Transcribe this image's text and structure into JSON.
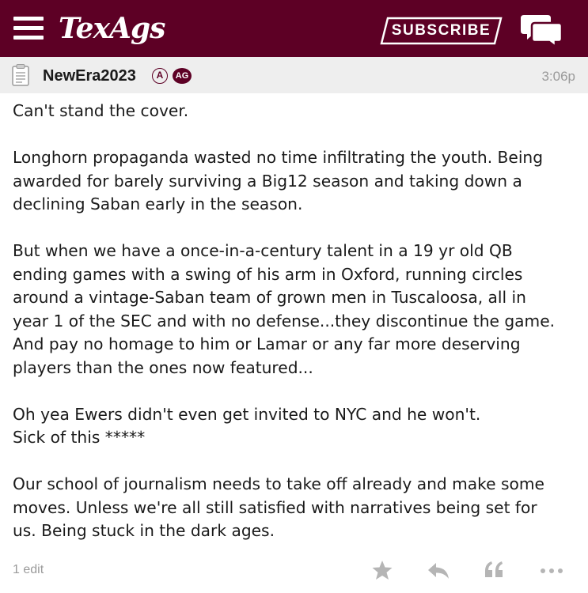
{
  "header": {
    "logo_text": "TexAgs",
    "subscribe_label": "SUBSCRIBE",
    "brand_color": "#5d0025",
    "menu_icon": "hamburger-menu-icon",
    "chat_icon": "chat-bubbles-icon"
  },
  "post": {
    "author": "NewEra2023",
    "badge_a": "A",
    "badge_ag": "AG",
    "time": "3:06p",
    "paragraphs": [
      [
        "Can't stand the cover."
      ],
      [
        "Longhorn propaganda wasted no time infiltrating the youth. Being",
        "awarded for barely surviving a Big12 season and taking down a",
        "declining Saban early in the season."
      ],
      [
        "But when we have a once-in-a-century talent in a 19 yr old QB",
        "ending games with a swing of his arm in Oxford, running circles",
        "around a vintage-Saban team of grown men in Tuscaloosa, all in",
        "year 1 of the SEC and with no defense...they discontinue the game.",
        "And pay no homage to him or Lamar or any far more deserving",
        "players than the ones now featured..."
      ],
      [
        "Oh yea Ewers didn't even get invited to NYC and he won't.",
        "Sick of this *****"
      ],
      [
        "Our school of journalism needs to take off already and make some",
        "moves. Unless we're all still satisfied with narratives being set for",
        "us. Being stuck in the dark ages."
      ]
    ],
    "edit_label": "1 edit"
  },
  "actions": [
    {
      "icon": "star-icon"
    },
    {
      "icon": "reply-icon"
    },
    {
      "icon": "quote-icon"
    },
    {
      "icon": "more-options-icon"
    }
  ]
}
